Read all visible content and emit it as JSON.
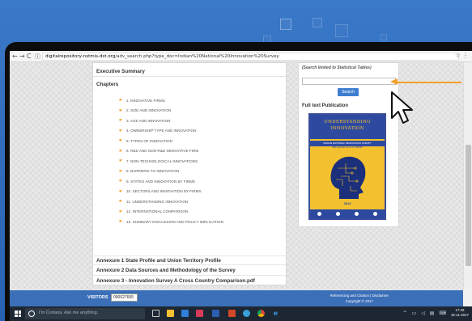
{
  "browser": {
    "url_host": "digitalrepository-nstmis-dst.org",
    "url_path": "/adv_search.php?type_doc=Indian%20National%20Innovation%20Survey",
    "nav_icons": [
      "back-icon",
      "forward-icon",
      "reload-icon",
      "info-icon"
    ]
  },
  "main": {
    "executive_summary": "Executive Summary",
    "chapters_heading": "Chapters",
    "chapters": [
      "1. INNOVATIVE FIRMS",
      "2. SIZE AND INNOVATION",
      "3. AGE AND INNOVATION",
      "4. OWNERSHIP TYPE AND INNOVATION",
      "5. TYPES OF INNOVATION",
      "6. R&D AND NON-R&D INNOVATIVE FIRM",
      "7. NON-TECHNOLOGICAL INNOVATIONS",
      "8. BARRIERS TO INNOVATION",
      "9. STATES AND INNOVATION BY FIRMS",
      "10. SECTORS AND INNOVATION BY FIRMS",
      "11. UNDERSTANDING INNOVATION",
      "12. INTERNATIONAL COMPARISON",
      "13. SUMMARY DISCUSSION AND POLICY IMPLICATION"
    ],
    "annexures": [
      "Annexure 1 State Profile and Union Territory Profile",
      "Annexure 2 Data Sources and Methodology of the Survey",
      "Annexure 3 - Innovation Survey A Cross Country Comparison.pdf"
    ]
  },
  "sidebar": {
    "search_note": "(Search limited to Statistical Tables)",
    "search_value": "",
    "search_button": "Search",
    "publication_heading": "Full text Publication",
    "cover": {
      "line1": "UNDERSTANDING",
      "line2": "INNOVATION",
      "subtitle": "INDIAN NATIONAL INNOVATION SURVEY",
      "subtitle2": "With special focus on MSMEs",
      "year": "2014",
      "bg_color": "#f3c12f",
      "band_color": "#2e4aa0"
    }
  },
  "footer": {
    "visitors_label": "VISITORS",
    "visitors_count": "000027665",
    "links": "Referencing and Citation | Disclaimer",
    "copyright": "Copyright © 2017"
  },
  "taskbar": {
    "cortana_placeholder": "I'm Cortana. Ask me anything.",
    "time": "17:29",
    "date": "16-11-2017"
  },
  "colors": {
    "accent": "#3b6fb8",
    "annotation_arrow": "#f2a12a"
  }
}
